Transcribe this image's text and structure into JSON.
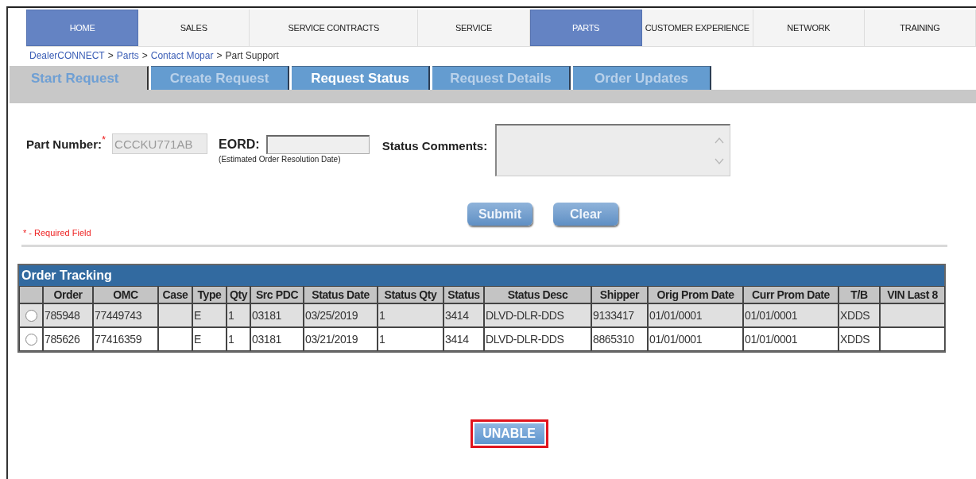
{
  "nav": [
    {
      "label": "HOME",
      "selected": true
    },
    {
      "label": "SALES",
      "selected": false,
      "wrap": false
    },
    {
      "label": "SERVICE CONTRACTS",
      "selected": false,
      "wrap": true
    },
    {
      "label": "SERVICE",
      "selected": false
    },
    {
      "label": "PARTS",
      "selected": true
    },
    {
      "label": "CUSTOMER EXPERIENCE",
      "selected": false
    },
    {
      "label": "NETWORK",
      "selected": false
    },
    {
      "label": "TRAINING",
      "selected": false
    }
  ],
  "breadcrumb": [
    {
      "label": "DealerCONNECT",
      "link": true
    },
    {
      "label": ">",
      "link": false
    },
    {
      "label": "Parts",
      "link": true
    },
    {
      "label": ">",
      "link": false
    },
    {
      "label": "Contact Mopar",
      "link": true
    },
    {
      "label": ">",
      "link": false
    },
    {
      "label": "Part Support",
      "link": false
    }
  ],
  "tabs": [
    {
      "label": "Start Request",
      "selected": true,
      "disabled": false
    },
    {
      "label": "Create Request",
      "selected": false,
      "disabled": true
    },
    {
      "label": "Request Status",
      "selected": false,
      "disabled": false
    },
    {
      "label": "Request Details",
      "selected": false,
      "disabled": true
    },
    {
      "label": "Order Updates",
      "selected": false,
      "disabled": true
    }
  ],
  "form": {
    "part_number": {
      "label": "Part Number:",
      "required_mark": "*",
      "value": "CCCKU771AB"
    },
    "eord": {
      "label": "EORD:",
      "hint": "(Estimated Order Resolution Date)"
    },
    "status_comments": {
      "label": "Status Comments:"
    },
    "buttons": [
      "Submit",
      "Clear"
    ],
    "required_note": "* - Required Field"
  },
  "order_tracking": {
    "title": "Order Tracking",
    "columns": [
      "",
      "Order",
      "OMC",
      "Case",
      "Type",
      "Qty",
      "Src PDC",
      "Status Date",
      "Status Qty",
      "Status",
      "Status Desc",
      "Shipper",
      "Orig Prom Date",
      "Curr Prom Date",
      "T/B",
      "VIN Last 8"
    ],
    "rows": [
      {
        "selected": false,
        "cells": [
          "",
          "785948",
          "77449743",
          "",
          "E",
          "1",
          "03181",
          "03/25/2019",
          "1",
          "3414",
          "DLVD-DLR-DDS",
          "9133417",
          "01/01/0001",
          "01/01/0001",
          "XDDS",
          ""
        ]
      },
      {
        "selected": false,
        "cells": [
          "",
          "785626",
          "77416359",
          "",
          "E",
          "1",
          "03181",
          "03/21/2019",
          "1",
          "3414",
          "DLVD-DLR-DDS",
          "8865310",
          "01/01/0001",
          "01/01/0001",
          "XDDS",
          ""
        ]
      }
    ]
  },
  "action_button": {
    "label": "UNABLE",
    "highlighted": true
  }
}
